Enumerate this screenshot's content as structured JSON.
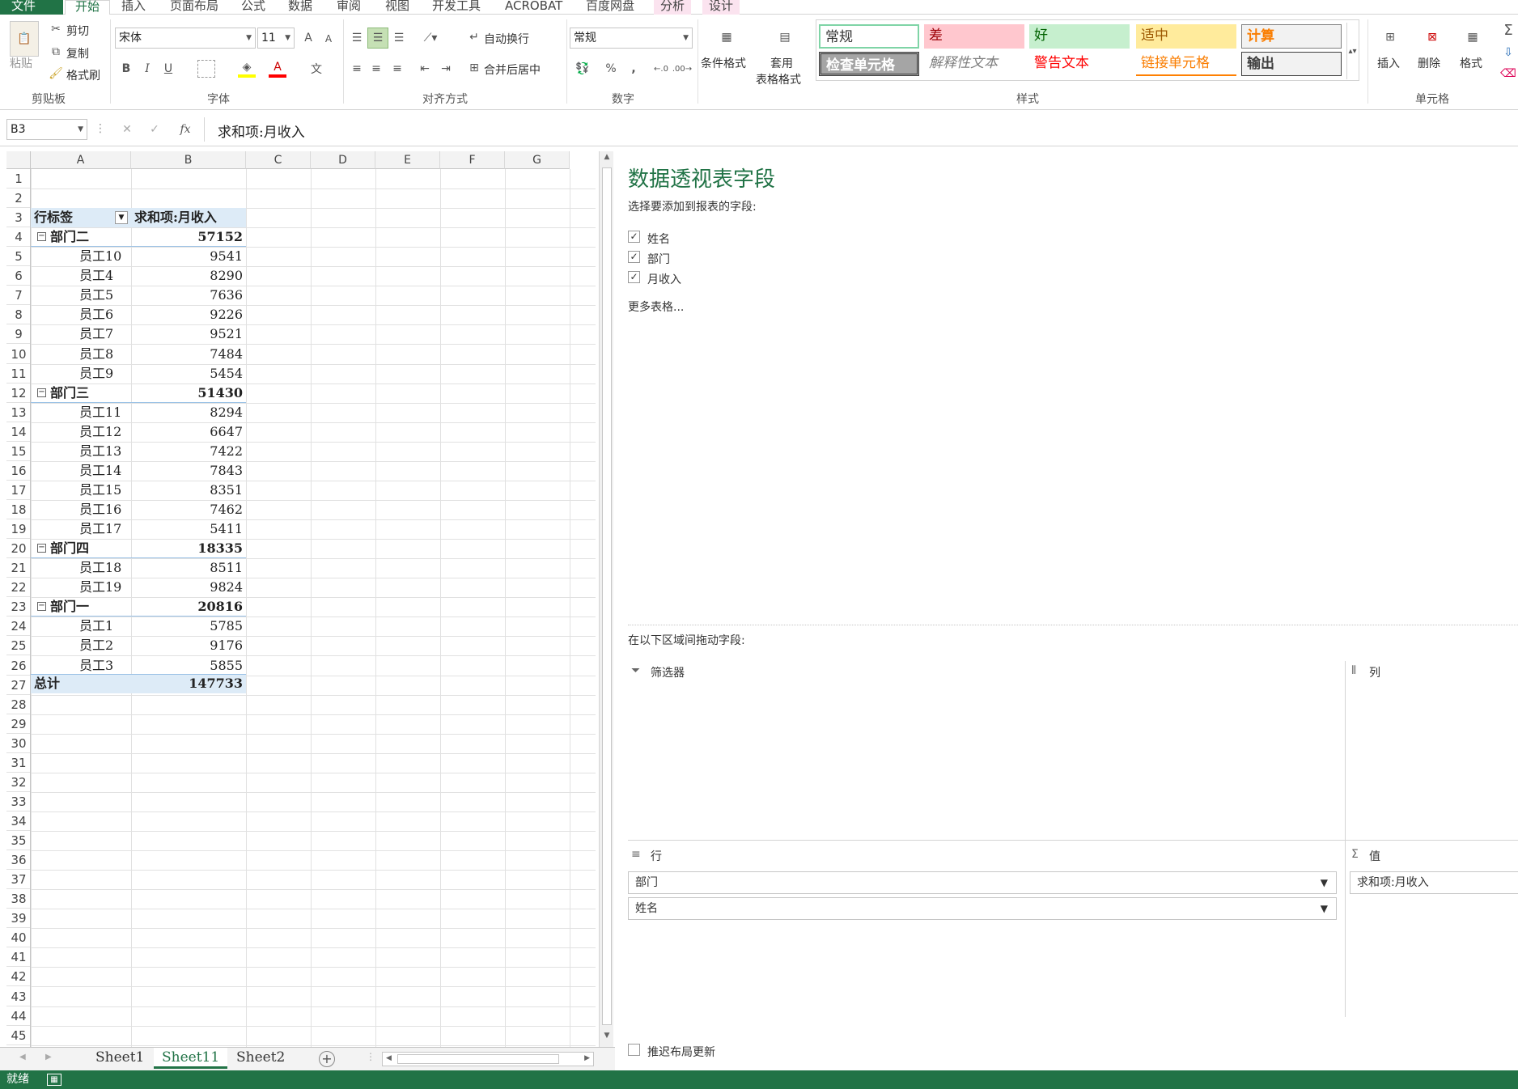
{
  "ribbon_tabs": [
    "文件",
    "开始",
    "插入",
    "页面布局",
    "公式",
    "数据",
    "审阅",
    "视图",
    "开发工具",
    "ACROBAT",
    "百度网盘",
    "分析",
    "设计"
  ],
  "clipboard": {
    "paste": "粘贴",
    "cut": "剪切",
    "copy": "复制",
    "format_painter": "格式刷",
    "label": "剪贴板"
  },
  "font": {
    "name": "宋体",
    "size": "11",
    "bold": "B",
    "italic": "I",
    "underline": "U",
    "label": "字体",
    "grow": "A",
    "shrink": "A",
    "font_color": "A",
    "phonetic": "文"
  },
  "alignment": {
    "wrap": "自动换行",
    "merge": "合并后居中",
    "label": "对齐方式"
  },
  "number": {
    "format": "常规",
    "percent": "%",
    "comma": ",",
    "label": "数字"
  },
  "styles": {
    "conditional": "条件格式",
    "table_fmt_1": "套用",
    "table_fmt_2": "表格格式",
    "normal": "常规",
    "bad": "差",
    "good": "好",
    "neutral": "适中",
    "calc": "计算",
    "check": "检查单元格",
    "explanatory": "解释性文本",
    "warning": "警告文本",
    "linked": "链接单元格",
    "output": "输出",
    "label": "样式"
  },
  "cells_group": {
    "insert": "插入",
    "delete": "删除",
    "format": "格式",
    "label": "单元格"
  },
  "formula_bar": {
    "name_box": "B3",
    "fx": "fx",
    "formula": "求和项:月收入"
  },
  "columns": [
    "A",
    "B",
    "C",
    "D",
    "E",
    "F",
    "G"
  ],
  "rows": [
    "1",
    "2",
    "3",
    "4",
    "5",
    "6",
    "7",
    "8",
    "9",
    "10",
    "11",
    "12",
    "13",
    "14",
    "15",
    "16",
    "17",
    "18",
    "19",
    "20",
    "21",
    "22",
    "23",
    "24",
    "25",
    "26",
    "27",
    "28",
    "29",
    "30",
    "31",
    "32",
    "33",
    "34",
    "35",
    "36",
    "37",
    "38",
    "39",
    "40",
    "41",
    "42",
    "43",
    "44",
    "45"
  ],
  "pivot": {
    "header_row": "行标签",
    "header_value": "求和项:月收入",
    "lines": [
      {
        "label": "部门二",
        "value": "57152",
        "type": "group"
      },
      {
        "label": "员工10",
        "value": "9541",
        "type": "item"
      },
      {
        "label": "员工4",
        "value": "8290",
        "type": "item"
      },
      {
        "label": "员工5",
        "value": "7636",
        "type": "item"
      },
      {
        "label": "员工6",
        "value": "9226",
        "type": "item"
      },
      {
        "label": "员工7",
        "value": "9521",
        "type": "item"
      },
      {
        "label": "员工8",
        "value": "7484",
        "type": "item"
      },
      {
        "label": "员工9",
        "value": "5454",
        "type": "item"
      },
      {
        "label": "部门三",
        "value": "51430",
        "type": "group"
      },
      {
        "label": "员工11",
        "value": "8294",
        "type": "item"
      },
      {
        "label": "员工12",
        "value": "6647",
        "type": "item"
      },
      {
        "label": "员工13",
        "value": "7422",
        "type": "item"
      },
      {
        "label": "员工14",
        "value": "7843",
        "type": "item"
      },
      {
        "label": "员工15",
        "value": "8351",
        "type": "item"
      },
      {
        "label": "员工16",
        "value": "7462",
        "type": "item"
      },
      {
        "label": "员工17",
        "value": "5411",
        "type": "item"
      },
      {
        "label": "部门四",
        "value": "18335",
        "type": "group"
      },
      {
        "label": "员工18",
        "value": "8511",
        "type": "item"
      },
      {
        "label": "员工19",
        "value": "9824",
        "type": "item"
      },
      {
        "label": "部门一",
        "value": "20816",
        "type": "group"
      },
      {
        "label": "员工1",
        "value": "5785",
        "type": "item"
      },
      {
        "label": "员工2",
        "value": "9176",
        "type": "item"
      },
      {
        "label": "员工3",
        "value": "5855",
        "type": "item"
      }
    ],
    "total_label": "总计",
    "total_value": "147733"
  },
  "sheet_tabs": [
    "Sheet1",
    "Sheet11",
    "Sheet2"
  ],
  "active_sheet": "Sheet11",
  "pane": {
    "title": "数据透视表字段",
    "choose": "选择要添加到报表的字段:",
    "fields": [
      "姓名",
      "部门",
      "月收入"
    ],
    "more": "更多表格...",
    "drag": "在以下区域间拖动字段:",
    "filters": "筛选器",
    "columns": "列",
    "rows": "行",
    "values": "值",
    "row_fields": [
      "部门",
      "姓名"
    ],
    "value_fields": [
      "求和项:月收入"
    ],
    "defer": "推迟布局更新"
  },
  "status": {
    "ready": "就绪"
  },
  "colors": {
    "accent": "#217346",
    "pivot_header": "#ddebf7"
  }
}
